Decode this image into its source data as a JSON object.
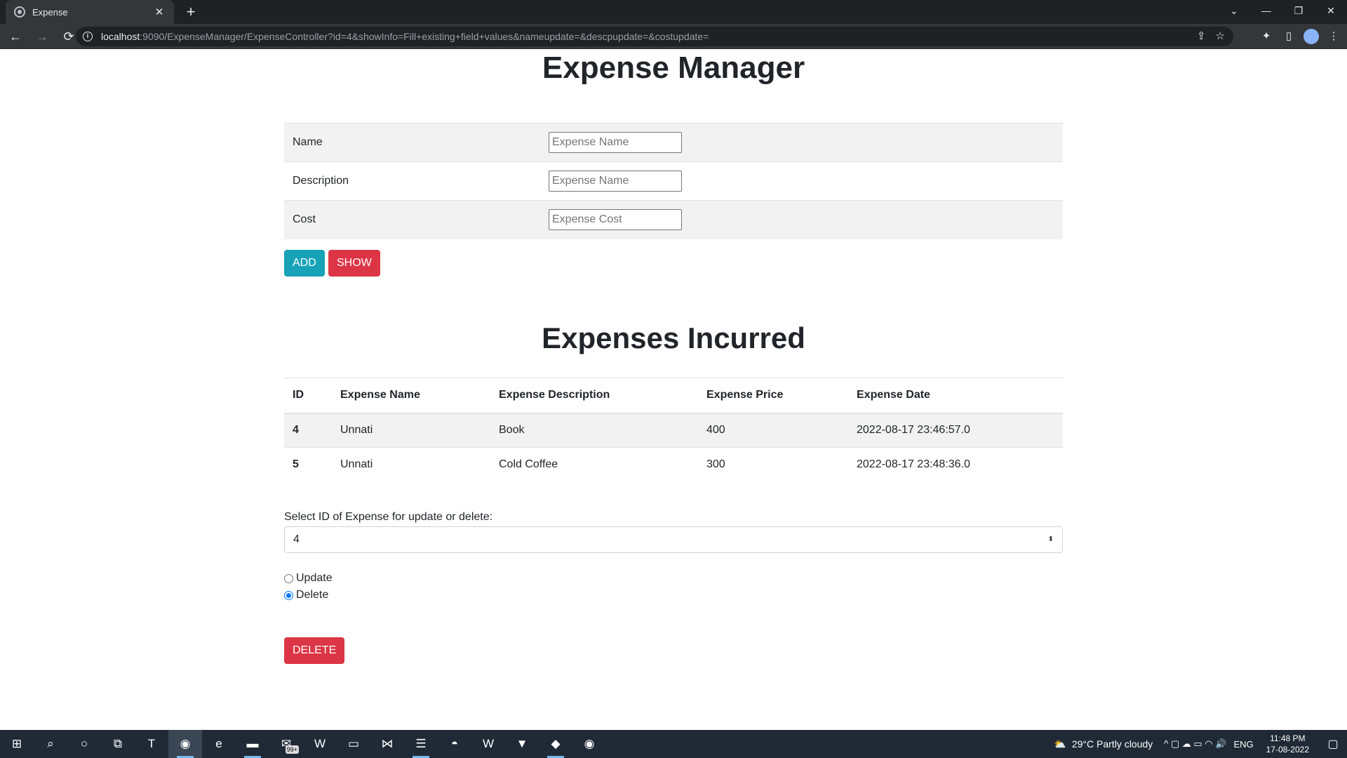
{
  "browser": {
    "tab_title": "Expense",
    "tab_close": "✕",
    "new_tab": "+",
    "url_host": "localhost",
    "url_rest": ":9090/ExpenseManager/ExpenseController?id=4&showInfo=Fill+existing+field+values&nameupdate=&descpupdate=&costupdate=",
    "nav": {
      "back": "←",
      "forward": "→",
      "reload": "⟳"
    },
    "window": {
      "dropdown": "⌄",
      "minimize": "—",
      "restore": "❐",
      "close": "✕"
    },
    "omni_icons": {
      "share": "⇪",
      "bookmark": "☆"
    },
    "ext_icons": {
      "extensions": "✦",
      "sidebar": "▯",
      "avatar": "●",
      "menu": "⋮"
    }
  },
  "page": {
    "title": "Expense Manager",
    "form": {
      "rows": [
        {
          "label": "Name",
          "placeholder": "Expense Name"
        },
        {
          "label": "Description",
          "placeholder": "Expense Name"
        },
        {
          "label": "Cost",
          "placeholder": "Expense Cost"
        }
      ],
      "add_label": "ADD",
      "show_label": "SHOW"
    },
    "section_title": "Expenses Incurred",
    "table": {
      "headers": [
        "ID",
        "Expense Name",
        "Expense Description",
        "Expense Price",
        "Expense Date"
      ],
      "rows": [
        [
          "4",
          "Unnati",
          "Book",
          "400",
          "2022-08-17 23:46:57.0"
        ],
        [
          "5",
          "Unnati",
          "Cold Coffee",
          "300",
          "2022-08-17 23:48:36.0"
        ]
      ]
    },
    "select": {
      "label": "Select ID of Expense for update or delete:",
      "value": "4",
      "caret": "⬍"
    },
    "radios": [
      {
        "label": "Update",
        "checked": false
      },
      {
        "label": "Delete",
        "checked": true
      }
    ],
    "delete_label": "DELETE"
  },
  "taskbar": {
    "apps": [
      {
        "name": "windows-start",
        "glyph": "⊞"
      },
      {
        "name": "search",
        "glyph": "⌕"
      },
      {
        "name": "cortana",
        "glyph": "○"
      },
      {
        "name": "task-view",
        "glyph": "⧉"
      },
      {
        "name": "teams",
        "glyph": "T"
      },
      {
        "name": "chrome",
        "glyph": "◉"
      },
      {
        "name": "edge",
        "glyph": "e"
      },
      {
        "name": "file-explorer",
        "glyph": "▬"
      },
      {
        "name": "mail",
        "glyph": "✉"
      },
      {
        "name": "app-w",
        "glyph": "W"
      },
      {
        "name": "terminal",
        "glyph": "▭"
      },
      {
        "name": "vscode",
        "glyph": "⋈"
      },
      {
        "name": "eclipse",
        "glyph": "☰"
      },
      {
        "name": "discord",
        "glyph": "◓"
      },
      {
        "name": "word",
        "glyph": "W"
      },
      {
        "name": "brave",
        "glyph": "▼"
      },
      {
        "name": "app-ide",
        "glyph": "◆"
      },
      {
        "name": "chrome-2",
        "glyph": "◉"
      }
    ],
    "mail_badge": "99+",
    "weather_icon": "⛅",
    "weather": "29°C  Partly cloudy",
    "sys_icons": "^  ▢  ☁  ▭  ◠  🔊",
    "lang": "ENG",
    "time": "11:48 PM",
    "date": "17-08-2022",
    "notification": "▢"
  }
}
